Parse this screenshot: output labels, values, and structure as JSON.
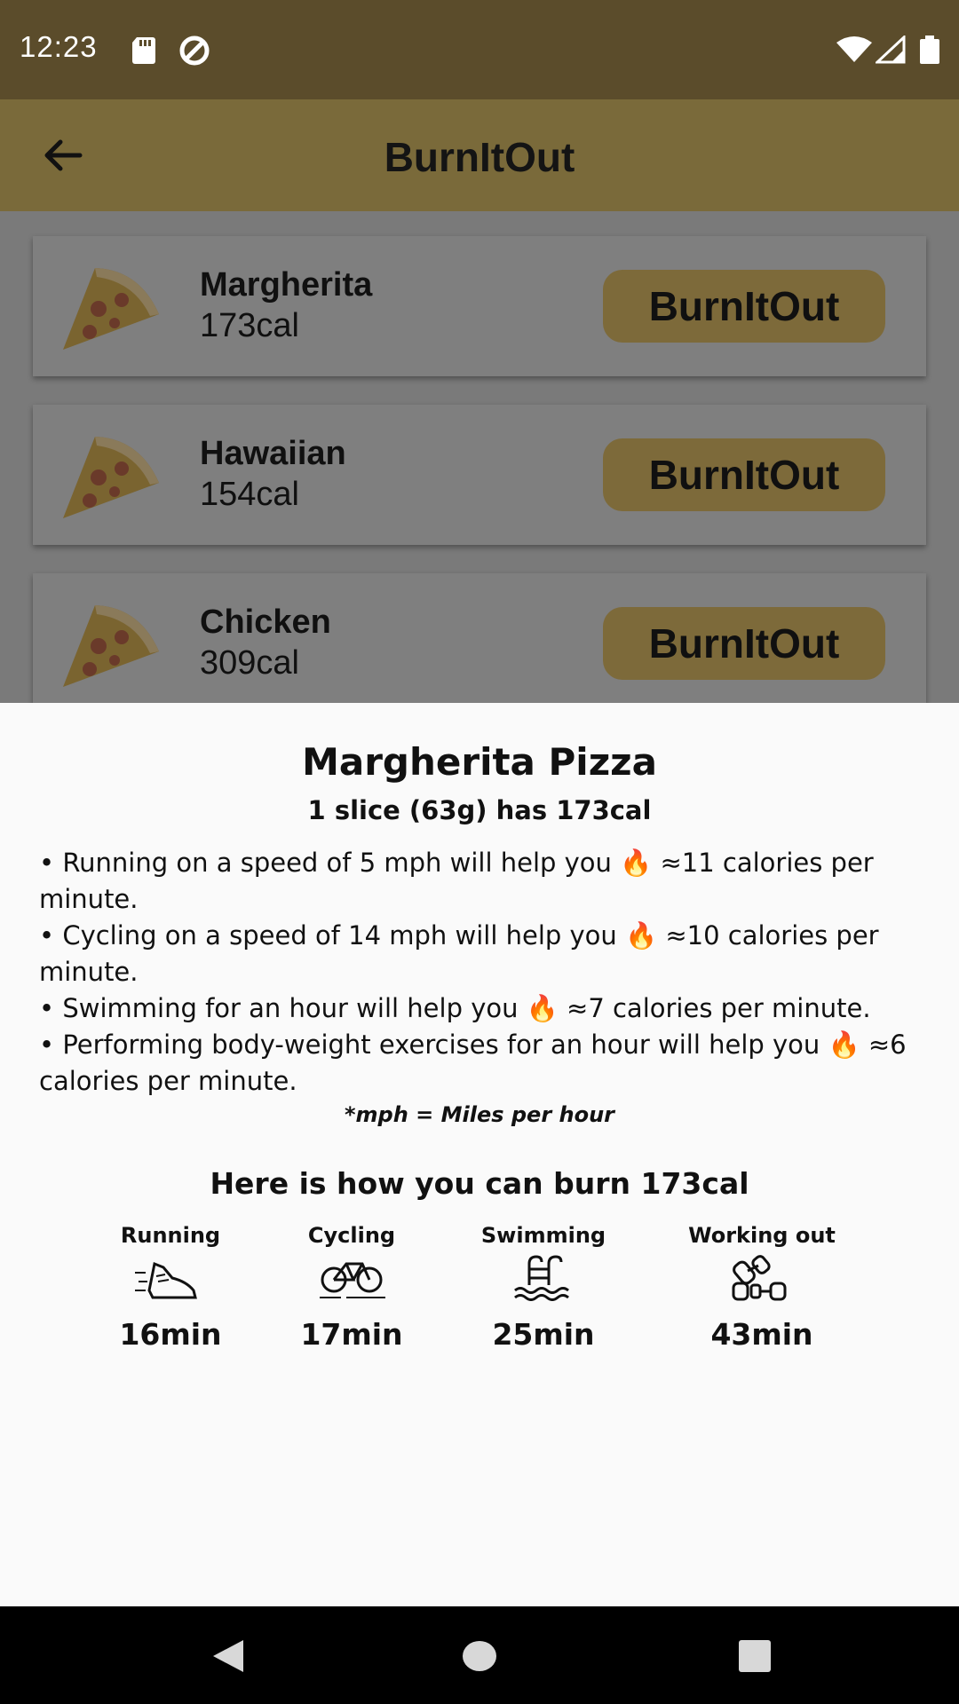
{
  "status_bar": {
    "time": "12:23"
  },
  "app_bar": {
    "title": "BurnItOut"
  },
  "list": [
    {
      "name": "Margherita",
      "calories": "173cal",
      "button": "BurnItOut"
    },
    {
      "name": "Hawaiian",
      "calories": "154cal",
      "button": "BurnItOut"
    },
    {
      "name": "Chicken",
      "calories": "309cal",
      "button": "BurnItOut"
    }
  ],
  "sheet": {
    "title": "Margherita Pizza",
    "subtitle": "1 slice (63g) has 173cal",
    "bullets": [
      "• Running on a speed of 5 mph will help you 🔥 ≈11 calories per minute.",
      "• Cycling on a speed of 14 mph will help you 🔥 ≈10 calories per minute.",
      "• Swimming for an hour will help you 🔥 ≈7 calories per minute.",
      "• Performing body-weight exercises for an hour will help you 🔥 ≈6 calories per minute."
    ],
    "note": "*mph = Miles per hour",
    "burn_heading": "Here is how you can burn 173cal",
    "activities": [
      {
        "label": "Running",
        "icon": "running-shoe-icon",
        "duration": "16min"
      },
      {
        "label": "Cycling",
        "icon": "bicycle-icon",
        "duration": "17min"
      },
      {
        "label": "Swimming",
        "icon": "pool-ladder-icon",
        "duration": "25min"
      },
      {
        "label": "Working out",
        "icon": "dumbbell-icon",
        "duration": "43min"
      }
    ]
  }
}
